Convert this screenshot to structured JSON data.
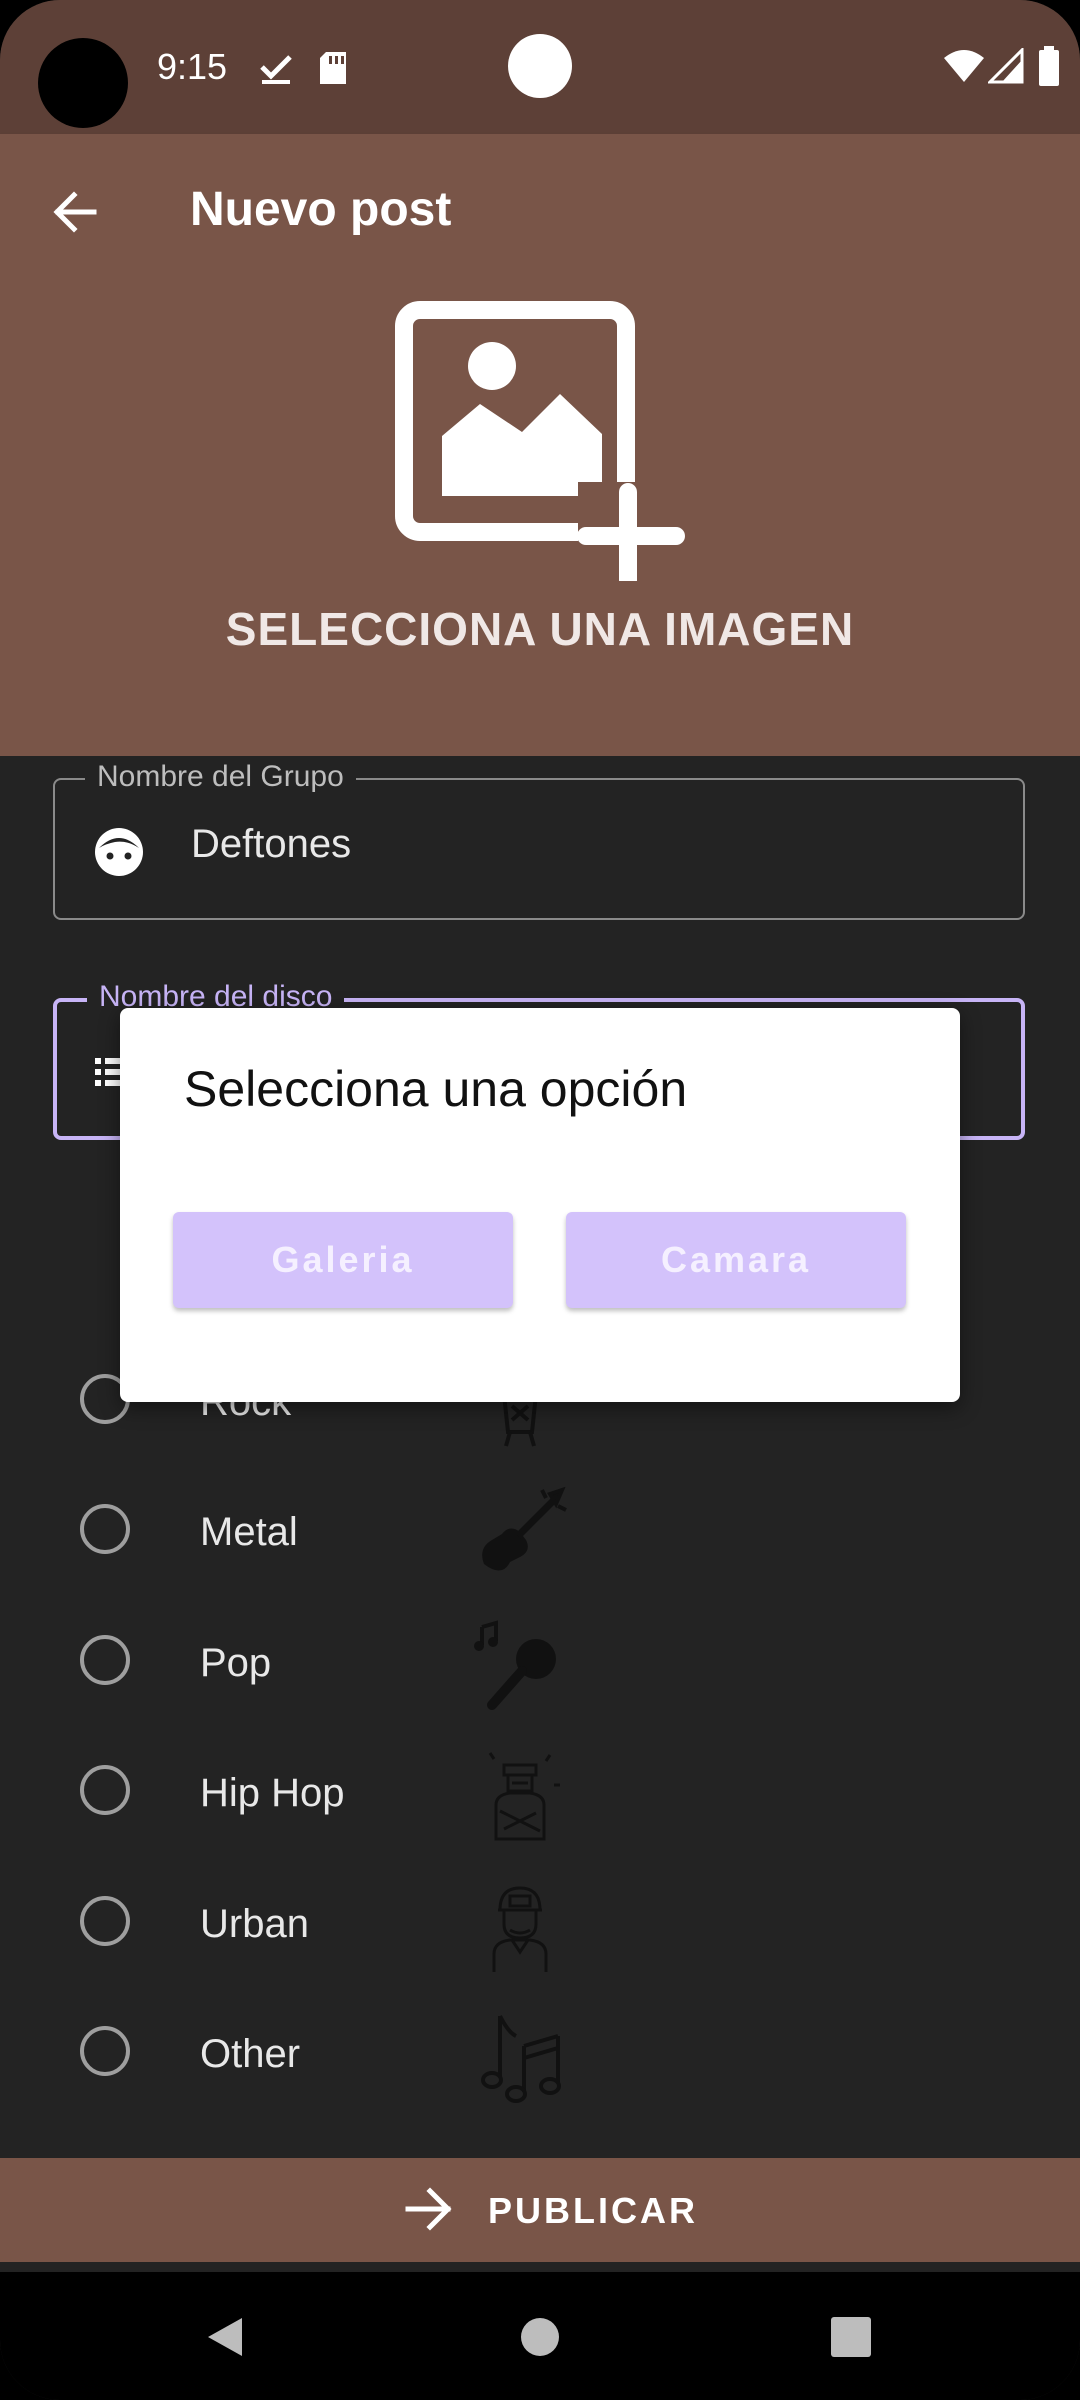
{
  "status_bar": {
    "time": "9:15"
  },
  "app_bar": {
    "title": "Nuevo post"
  },
  "image_picker": {
    "label": "SELECCIONA UNA IMAGEN"
  },
  "fields": {
    "band": {
      "label": "Nombre del Grupo",
      "value": "Deftones"
    },
    "album": {
      "label": "Nombre del disco",
      "value": ""
    }
  },
  "genres": [
    {
      "label": "Rock",
      "icon": "rocker-icon"
    },
    {
      "label": "Metal",
      "icon": "guitar-icon"
    },
    {
      "label": "Pop",
      "icon": "microphone-icon"
    },
    {
      "label": "Hip Hop",
      "icon": "hiphop-icon"
    },
    {
      "label": "Urban",
      "icon": "urban-icon"
    },
    {
      "label": "Other",
      "icon": "music-notes-icon"
    }
  ],
  "publish": {
    "label": "PUBLICAR"
  },
  "dialog": {
    "title": "Selecciona una opción",
    "gallery_label": "Galeria",
    "camera_label": "Camara"
  },
  "colors": {
    "status_bar": "#5d4037",
    "primary": "#795548",
    "accent": "#c7b4f6",
    "background": "#232323",
    "dialog_button": "#d3c2fb"
  }
}
